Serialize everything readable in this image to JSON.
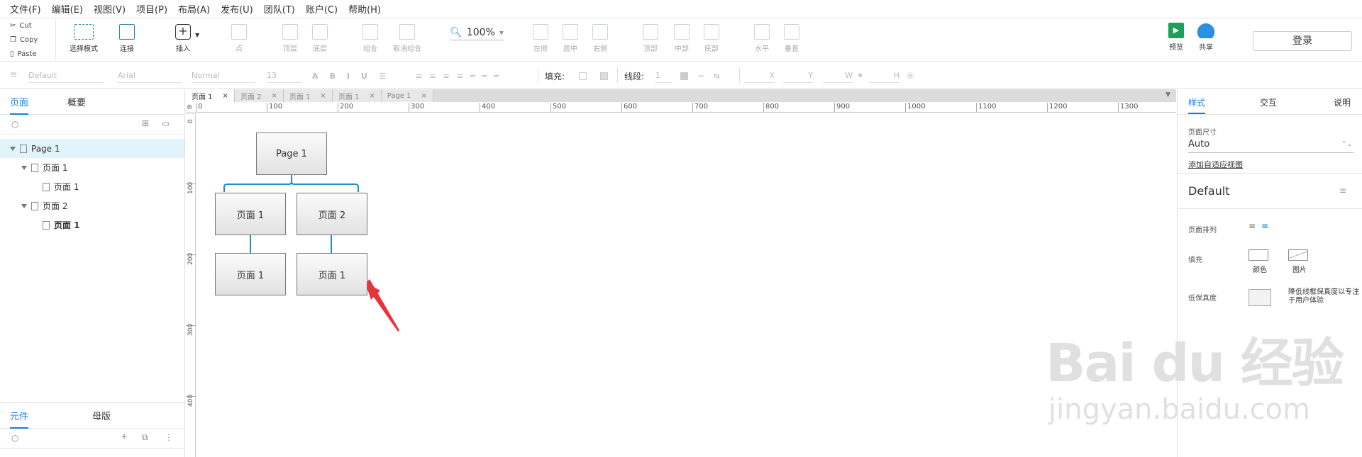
{
  "menu": [
    "文件(F)",
    "编辑(E)",
    "视图(V)",
    "项目(P)",
    "布局(A)",
    "发布(U)",
    "团队(T)",
    "账户(C)",
    "帮助(H)"
  ],
  "clipboard": [
    "Cut",
    "Copy",
    "Paste"
  ],
  "toolbar": {
    "select_mode": "选择模式",
    "connect": "连接",
    "insert": "插入",
    "point": "点",
    "top_layer": "顶层",
    "bottom_layer": "底层",
    "group": "组合",
    "ungroup": "取消组合",
    "zoom": "100%",
    "align_left": "左侧",
    "align_center": "居中",
    "align_right": "右侧",
    "align_top": "顶部",
    "align_middle": "中部",
    "align_bottom": "底部",
    "horizontal": "水平",
    "vertical": "垂直",
    "preview": "预览",
    "share": "共享",
    "login": "登录"
  },
  "format": {
    "style": "Default",
    "font": "Arial",
    "weight": "Normal",
    "size": "13",
    "fill_label": "填充:",
    "line_label": "线段:",
    "line_value": "1",
    "x": "X",
    "y": "Y",
    "w": "W",
    "h": "H"
  },
  "left_panel": {
    "tab_pages": "页面",
    "tab_outline": "概要",
    "tree": [
      {
        "label": "Page 1",
        "level": 0
      },
      {
        "label": "页面 1",
        "level": 1
      },
      {
        "label": "页面 1",
        "level": 2
      },
      {
        "label": "页面 2",
        "level": 1
      },
      {
        "label": "页面 1",
        "level": 2
      }
    ],
    "tab_widgets": "元件",
    "tab_masters": "母版"
  },
  "doc_tabs": [
    "页面 1",
    "页面 2",
    "页面 1",
    "页面 1",
    "Page 1"
  ],
  "ruler": {
    "h": [
      "0",
      "100",
      "200",
      "300",
      "400",
      "500",
      "600",
      "700",
      "800",
      "900",
      "1000",
      "1100",
      "1200",
      "1300"
    ],
    "v": [
      "0",
      "100",
      "200",
      "300",
      "400"
    ]
  },
  "diagram": {
    "root": "Page 1",
    "level1": [
      "页面 1",
      "页面 2"
    ],
    "level2": [
      "页面 1",
      "页面 1"
    ]
  },
  "right_panel": {
    "tab_style": "样式",
    "tab_interact": "交互",
    "tab_notes": "说明",
    "page_size_label": "页面尺寸",
    "page_size_value": "Auto",
    "adaptive_link": "添加自适应视图",
    "style_name": "Default",
    "align_label": "页面排列",
    "fill_label": "填充",
    "fill_color": "颜色",
    "fill_image": "图片",
    "low_fidelity_label": "低保真度",
    "low_fidelity_desc": "降低线框保真度以专注于用户体验"
  },
  "watermark": {
    "brand": "Bai du 经验",
    "url": "jingyan.baidu.com"
  }
}
